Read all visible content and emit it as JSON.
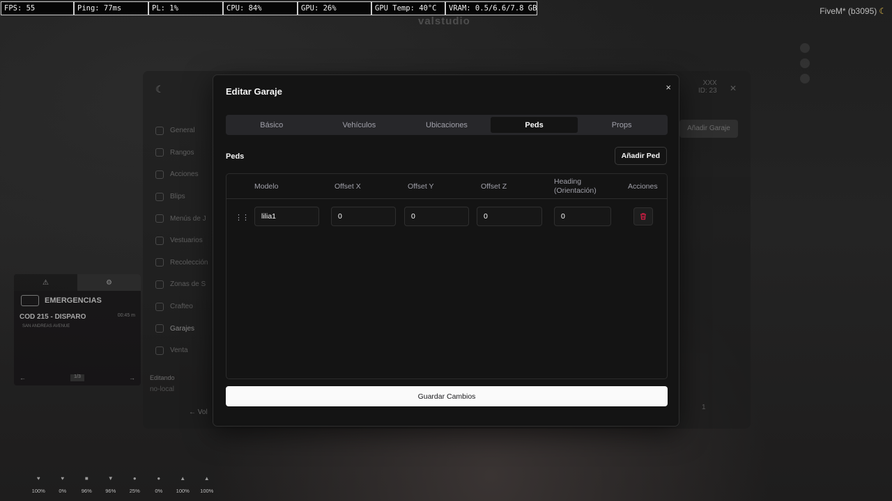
{
  "perf": {
    "fps": "FPS: 55",
    "ping": "Ping: 77ms",
    "pl": "PL: 1%",
    "cpu": "CPU: 84%",
    "gpu": "GPU: 26%",
    "gpu_temp": "GPU Temp: 40°C",
    "vram": "VRAM: 0.5/6.6/7.8 GB"
  },
  "client": {
    "name": "FiveM* (b3095)",
    "icon": "moon-icon"
  },
  "background_panel": {
    "nav": [
      "General",
      "Rangos",
      "Acciones",
      "Blips",
      "Menús de J",
      "Vestuarios",
      "Recolección",
      "Zonas de S",
      "Crafteo",
      "Garajes",
      "Venta"
    ],
    "active_nav": "Garajes",
    "editing_label": "Editando",
    "editing_value": "no-local",
    "back_label": "Vol",
    "user_name": "XXX",
    "user_id": "ID: 23",
    "add_garage": "Añadir Garaje",
    "page": "1"
  },
  "emergency": {
    "title": "EMERGENCIAS",
    "code": "COD 215 - DISPARO",
    "time": "00:45 m",
    "street": "SAN ANDREAS AVENUE",
    "page": "1/3"
  },
  "status_hud": [
    "100%",
    "0%",
    "96%",
    "96%",
    "25%",
    "0%",
    "100%",
    "100%"
  ],
  "modal": {
    "title": "Editar Garaje",
    "close": "×",
    "tabs": [
      "Básico",
      "Vehículos",
      "Ubicaciones",
      "Peds",
      "Props"
    ],
    "active_tab": "Peds",
    "section_title": "Peds",
    "add_button": "Añadir Ped",
    "columns": {
      "model": "Modelo",
      "offset_x": "Offset X",
      "offset_y": "Offset Y",
      "offset_z": "Offset Z",
      "heading": "Heading (Orientación)",
      "actions": "Acciones"
    },
    "rows": [
      {
        "model": "lilia1",
        "offset_x": "0",
        "offset_y": "0",
        "offset_z": "0",
        "heading": "0"
      }
    ],
    "save_button": "Guardar Cambios"
  },
  "colors": {
    "accent_delete": "#e11d48",
    "modal_bg": "#141414",
    "save_bg": "#fafafa"
  }
}
